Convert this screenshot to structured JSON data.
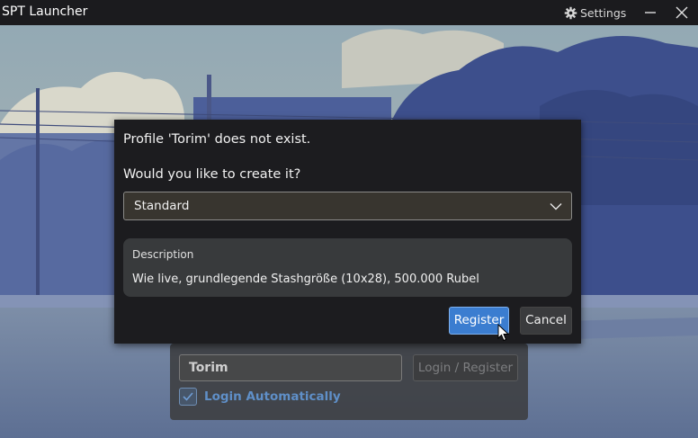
{
  "window": {
    "title": "SPT Launcher",
    "settings_label": "Settings",
    "icons": {
      "settings": "gear-icon",
      "minimize": "minimize-icon",
      "close": "close-icon"
    }
  },
  "dialog": {
    "message": "Profile 'Torim' does not exist.",
    "question": "Would you like to create it?",
    "edition": {
      "selected": "Standard",
      "icon": "chevron-down-icon"
    },
    "description": {
      "title": "Description",
      "text": "Wie live, grundlegende Stashgröße (10x28), 500.000 Rubel"
    },
    "register_label": "Register",
    "cancel_label": "Cancel"
  },
  "login": {
    "username_value": "Torim",
    "login_register_label": "Login / Register",
    "auto_login_label": "Login Automatically",
    "auto_login_checked": true
  },
  "colors": {
    "accent": "#3b7dd0",
    "titlebar_bg": "#1b1b1e",
    "dialog_bg": "#1c1c1f",
    "auto_login_text": "#5f8fc8"
  }
}
